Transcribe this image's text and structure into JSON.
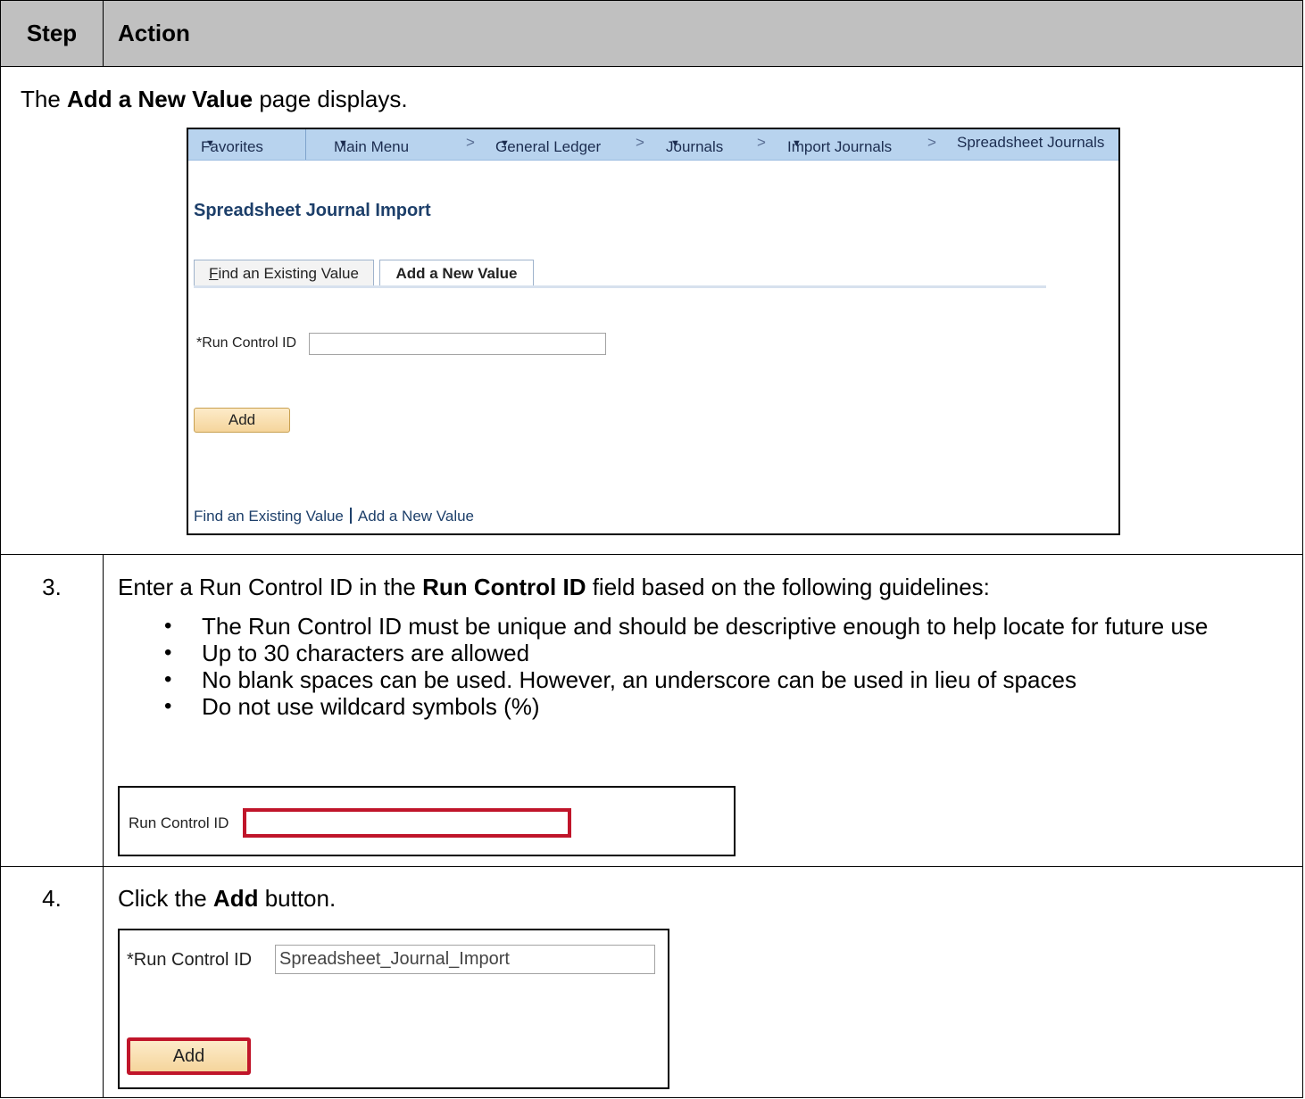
{
  "table_header": {
    "step": "Step",
    "action": "Action"
  },
  "intro": {
    "prefix": "The ",
    "bold": "Add a New Value",
    "suffix": " page displays."
  },
  "screenshot": {
    "nav": {
      "favorites": "Favorites",
      "main_menu": "Main Menu",
      "general_ledger": "General Ledger",
      "journals": "Journals",
      "import_journals": "Import Journals",
      "current": "Spreadsheet Journals"
    },
    "page_title": "Spreadsheet Journal Import",
    "tabs": {
      "find_first": "F",
      "find_rest": "ind an Existing Value",
      "add": "Add a New Value"
    },
    "run_control_label": "*Run Control ID",
    "run_control_value": "",
    "add_button": "Add",
    "footer": {
      "find": "Find an Existing Value",
      "add": "Add a New Value"
    }
  },
  "step3": {
    "number": "3.",
    "instruction_prefix": "Enter a Run Control ID in the ",
    "instruction_bold": "Run Control ID",
    "instruction_suffix": " field based on the following guidelines:",
    "bullets": [
      "The Run Control ID must be unique and should be descriptive enough to help locate for future use",
      "Up to 30 characters are allowed",
      "No blank spaces can be used. However, an underscore can be used in lieu of spaces",
      "Do not use wildcard symbols (%)"
    ],
    "field_label": "Run Control ID",
    "field_value": ""
  },
  "step4": {
    "number": "4.",
    "instruction_prefix": "Click the ",
    "instruction_bold": "Add",
    "instruction_suffix": " button.",
    "field_label": "*Run Control ID",
    "field_value": "Spreadsheet_Journal_Import",
    "button_label": "Add"
  },
  "colors": {
    "header_bg": "#c0c0c0",
    "nav_bg": "#b8d3ee",
    "highlight": "#c0152a",
    "title": "#1d3f6a"
  }
}
